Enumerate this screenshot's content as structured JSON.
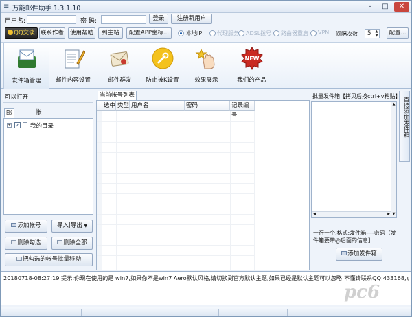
{
  "window": {
    "title": "万能邮件助手 1.3.1.10",
    "min": "–",
    "max": "□",
    "close": "✕"
  },
  "login": {
    "username_label": "用户名:",
    "username_value": "",
    "password_label": "密  码:",
    "password_value": "",
    "login_button": "登录",
    "register_button": "注册新用户"
  },
  "actions": {
    "qq_button": "QQ交谈",
    "contact_author": "联系作者",
    "help": "使用帮助",
    "home": "到主站",
    "config_app": "配置APP坐标...",
    "config": "配置..."
  },
  "ip_options": [
    {
      "label": "本地IP",
      "selected": true,
      "enabled": true
    },
    {
      "label": "代理服务",
      "selected": false,
      "enabled": false
    },
    {
      "label": "ADSL拨号",
      "selected": false,
      "enabled": false
    },
    {
      "label": "路由器重启",
      "selected": false,
      "enabled": false
    },
    {
      "label": "VPN",
      "selected": false,
      "enabled": false
    }
  ],
  "interval": {
    "label": "间隔次数",
    "value": "5"
  },
  "toolbar": [
    {
      "label": "发件箱管理",
      "icon": "outbox-icon",
      "active": true
    },
    {
      "label": "邮件内容设置",
      "icon": "document-pencil-icon",
      "active": false
    },
    {
      "label": "邮件群发",
      "icon": "envelope-icon",
      "active": false
    },
    {
      "label": "防止被K设置",
      "icon": "wrench-icon",
      "active": false
    },
    {
      "label": "效果展示",
      "icon": "hand-star-icon",
      "active": false
    },
    {
      "label": "我们的产品",
      "icon": "new-badge-icon",
      "active": false
    }
  ],
  "left": {
    "section_label": "可以打开",
    "tabs": [
      "邮箱帐号",
      "帐号移动目标"
    ],
    "tree_item": "我的目录",
    "buttons": {
      "add_account": "添加帐号",
      "import_export": "导入|导出",
      "delete_checked": "删除勾选",
      "delete_all": "删除全部",
      "batch_move": "把勾选的帐号批量移动"
    }
  },
  "grid": {
    "title": "当前帐号列表",
    "columns": [
      "选中",
      "类型",
      "用户名",
      "密码",
      "记录编号"
    ]
  },
  "right": {
    "title": "批量发件箱【拷贝后按ctrl+v粘贴】",
    "hint": "一行一个.格式:发件箱----密码【发件箱要带@后面的信息】",
    "add_button": "添加发件箱",
    "side_tab": "直接添加发件箱"
  },
  "status": {
    "text": "20180718-08:27:19  提示:你现在使用的是 win7,如果你不是win7 Aero默认风格,请切换到官方默认主题,如果已经是默认主题可以忽略!不懂请联系QQ:433168,点击打开帮助..."
  },
  "watermark": "pc6"
}
